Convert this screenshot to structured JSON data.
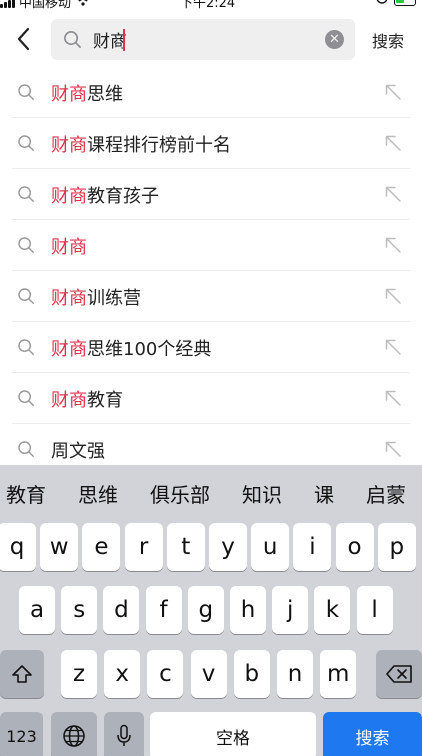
{
  "status_bar": {
    "carrier": "中国移动",
    "time": "下午2:24"
  },
  "header": {
    "search_value": "财商",
    "search_button": "搜索"
  },
  "suggestions": [
    {
      "highlight": "财商",
      "rest": "思维"
    },
    {
      "highlight": "财商",
      "rest": "课程排行榜前十名"
    },
    {
      "highlight": "财商",
      "rest": "教育孩子"
    },
    {
      "highlight": "财商",
      "rest": ""
    },
    {
      "highlight": "财商",
      "rest": "训练营"
    },
    {
      "highlight": "财商",
      "rest": "思维100个经典"
    },
    {
      "highlight": "财商",
      "rest": "教育"
    },
    {
      "highlight": "",
      "rest": "周文强"
    }
  ],
  "keyboard": {
    "candidates": [
      "教育",
      "思维",
      "俱乐部",
      "知识",
      "课",
      "启蒙"
    ],
    "row1": [
      "q",
      "w",
      "e",
      "r",
      "t",
      "y",
      "u",
      "i",
      "o",
      "p"
    ],
    "row2": [
      "a",
      "s",
      "d",
      "f",
      "g",
      "h",
      "j",
      "k",
      "l"
    ],
    "row3": [
      "z",
      "x",
      "c",
      "v",
      "b",
      "n",
      "m"
    ],
    "numbers_key": "123",
    "space_key": "空格",
    "action_key": "搜索"
  },
  "colors": {
    "highlight": "#e0344c",
    "action_blue": "#1e78f0"
  }
}
